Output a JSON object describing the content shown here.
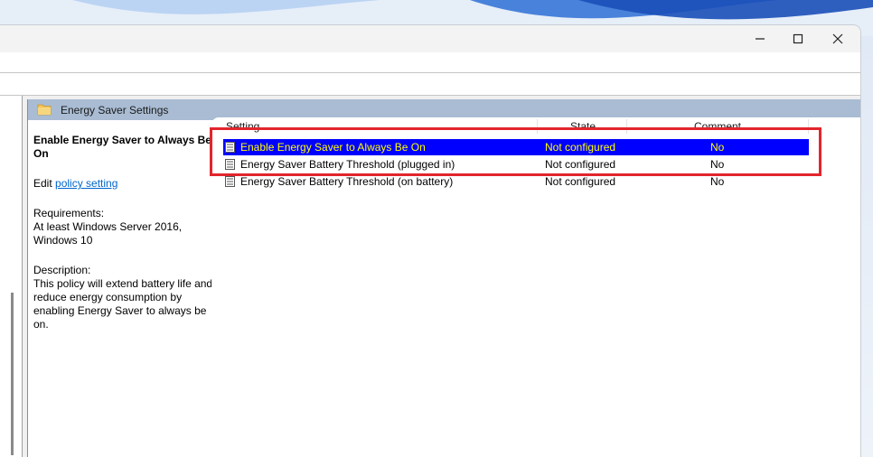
{
  "window": {
    "minimize_icon": "minimize-icon",
    "maximize_icon": "maximize-icon",
    "close_icon": "close-icon"
  },
  "pane": {
    "title": "Energy Saver Settings",
    "folder_icon": "folder-icon"
  },
  "description": {
    "title": "Enable Energy Saver to Always Be On",
    "edit_prefix": "Edit ",
    "edit_link": "policy setting",
    "requirements_label": "Requirements:",
    "requirements_text": "At least Windows Server 2016, Windows 10",
    "description_label": "Description:",
    "description_text": "This policy will extend battery life and reduce energy consumption by enabling Energy Saver to always be on."
  },
  "list": {
    "columns": [
      "Setting",
      "State",
      "Comment"
    ],
    "rows": [
      {
        "setting": "Enable Energy Saver to Always Be On",
        "state": "Not configured",
        "comment": "No",
        "selected": true
      },
      {
        "setting": "Energy Saver Battery Threshold (plugged in)",
        "state": "Not configured",
        "comment": "No",
        "selected": false
      },
      {
        "setting": "Energy Saver Battery Threshold (on battery)",
        "state": "Not configured",
        "comment": "No",
        "selected": false
      }
    ]
  },
  "colors": {
    "selection_bg": "#0000ff",
    "selection_text": "#ffff00",
    "highlight_box": "#e2252d",
    "pane_header": "#a9bcd3"
  }
}
